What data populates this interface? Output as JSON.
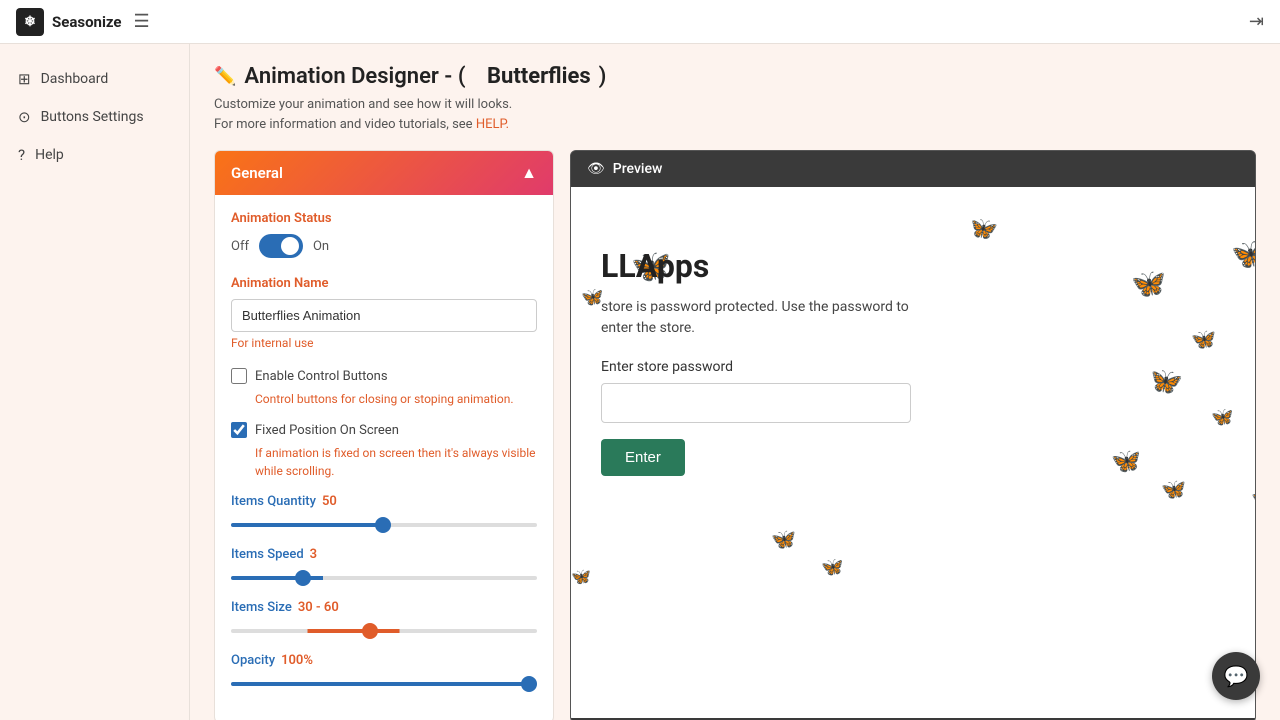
{
  "app": {
    "name": "Seasonize",
    "logo_char": "❄"
  },
  "topbar": {
    "logout_icon": "⇥"
  },
  "sidebar": {
    "items": [
      {
        "id": "dashboard",
        "label": "Dashboard",
        "icon": "⊞"
      },
      {
        "id": "buttons-settings",
        "label": "Buttons Settings",
        "icon": "⊙"
      },
      {
        "id": "help",
        "label": "Help",
        "icon": "?"
      }
    ]
  },
  "page": {
    "title_prefix": "Animation Designer - (",
    "app_name": "Butterflies",
    "title_suffix": ")",
    "subtitle_line1": "Customize your animation and see how it will looks.",
    "subtitle_line2": "For more information and video tutorials, see",
    "help_link": "HELP."
  },
  "general_panel": {
    "header": "General",
    "animation_status_label": "Animation Status",
    "toggle_off": "Off",
    "toggle_on": "On",
    "animation_name_label": "Animation Name",
    "animation_name_value": "Butterflies Animation",
    "animation_name_placeholder": "Butterflies Animation",
    "internal_use_text": "For internal use",
    "enable_control_label": "Enable Control Buttons",
    "enable_control_desc": "Control buttons for closing or stoping animation.",
    "enable_control_checked": false,
    "fixed_position_label": "Fixed Position On Screen",
    "fixed_position_desc": "If animation is fixed on screen then it's always visible while scrolling.",
    "fixed_position_checked": true,
    "items_quantity_label": "Items Quantity",
    "items_quantity_value": "50",
    "items_speed_label": "Items Speed",
    "items_speed_value": "3",
    "items_size_label": "Items Size",
    "items_size_value": "30 - 60",
    "opacity_label": "Opacity",
    "opacity_value": "100",
    "opacity_suffix": "%"
  },
  "preview": {
    "header": "Preview",
    "store_title": "LLApps",
    "store_desc_line1": "store is password protected. Use the password to",
    "store_desc_line2": "enter the store.",
    "password_label": "Enter store password",
    "enter_button": "Enter"
  },
  "chat": {
    "icon": "💬"
  }
}
